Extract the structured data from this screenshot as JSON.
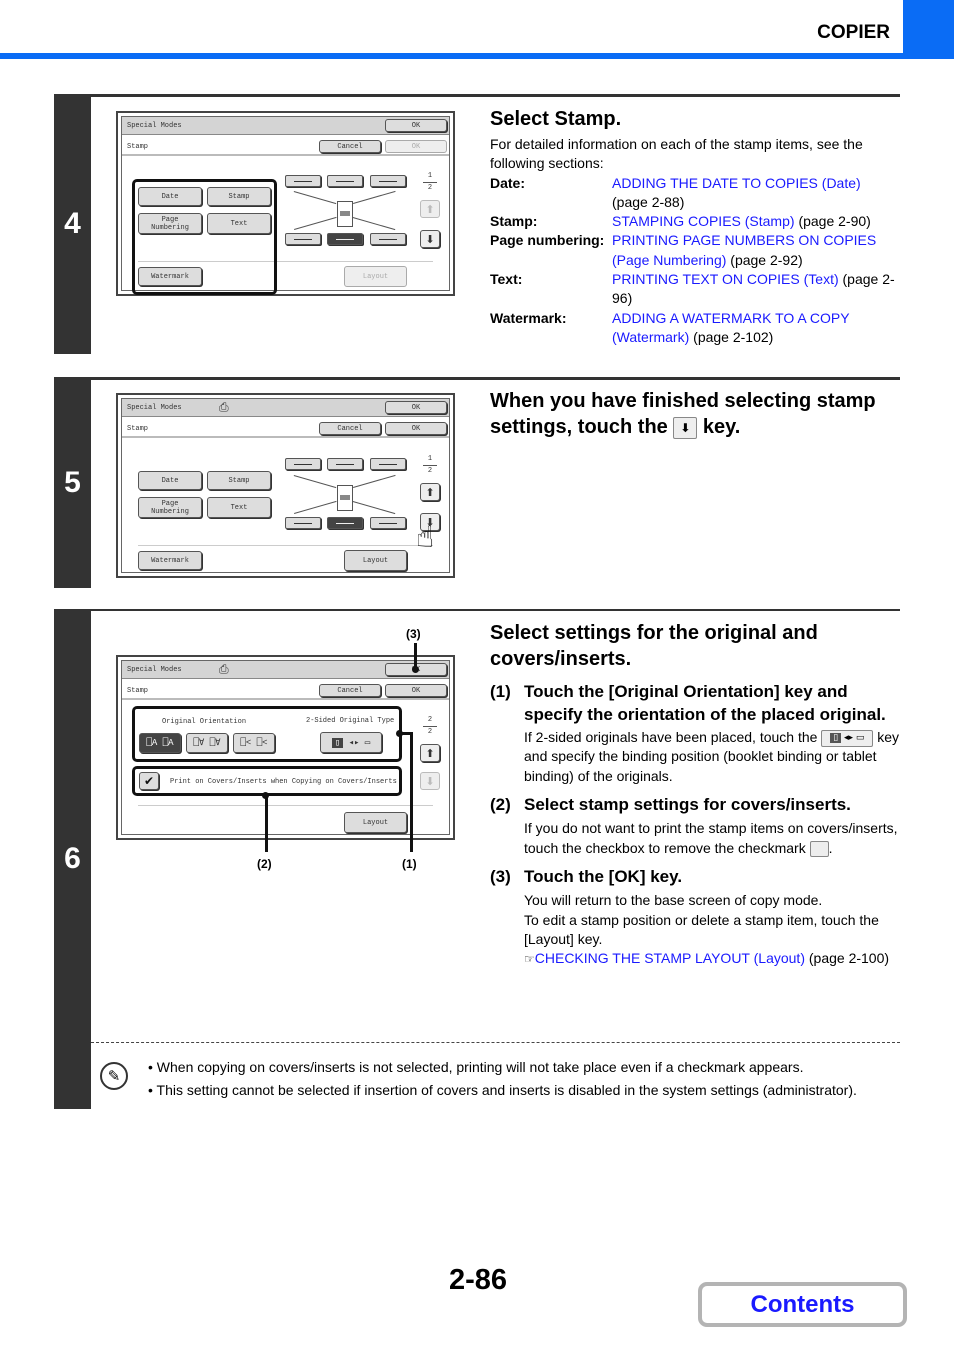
{
  "header": {
    "section_title": "COPIER",
    "accent_color": "#0a6cf5"
  },
  "steps": [
    {
      "number": "4",
      "title": "Select Stamp.",
      "intro": "For detailed information on each of the stamp items, see the following sections:",
      "refs": [
        {
          "term": "Date:",
          "link": "ADDING THE DATE TO COPIES (Date)",
          "page": "(page 2-88)"
        },
        {
          "term": "Stamp:",
          "link": "STAMPING COPIES (Stamp)",
          "page": "(page 2-90)"
        },
        {
          "term": "Page numbering:",
          "link": "PRINTING PAGE NUMBERS ON COPIES (Page Numbering)",
          "page": "(page 2-92)"
        },
        {
          "term": "Text:",
          "link": "PRINTING TEXT ON COPIES (Text)",
          "page": "(page 2-96)"
        },
        {
          "term": "Watermark:",
          "link": "ADDING A WATERMARK TO A COPY (Watermark)",
          "page": "(page 2-102)"
        }
      ],
      "screen": {
        "special_modes": "Special Modes",
        "ok": "OK",
        "stamp": "Stamp",
        "cancel": "Cancel",
        "buttons": [
          "Date",
          "Stamp",
          "Page\nNumbering",
          "Text"
        ],
        "watermark": "Watermark",
        "layout": "Layout",
        "page_current": "1",
        "page_total": "2"
      }
    },
    {
      "number": "5",
      "title_before": "When you have finished selecting stamp settings, touch the",
      "key_icon": "down-arrow",
      "title_after": "key.",
      "screen": {
        "special_modes": "Special Modes",
        "ok": "OK",
        "stamp": "Stamp",
        "cancel": "Cancel",
        "ok2": "OK",
        "buttons": [
          "Date",
          "Stamp",
          "Page\nNumbering",
          "Text"
        ],
        "watermark": "Watermark",
        "layout": "Layout",
        "page_current": "1",
        "page_total": "2"
      }
    },
    {
      "number": "6",
      "title": "Select settings for the original and covers/inserts.",
      "subs": [
        {
          "num": "(1)",
          "title": "Touch the [Original Orientation] key and specify the orientation of the placed original.",
          "text_before": "If 2-sided originals have been placed, touch the",
          "text_after": "key and specify the binding position (booklet binding or tablet binding) of the originals."
        },
        {
          "num": "(2)",
          "title": "Select stamp settings for covers/inserts.",
          "text_before": "If you do not want to print the stamp items on covers/inserts, touch the checkbox to remove the checkmark",
          "text_after": "."
        },
        {
          "num": "(3)",
          "title": "Touch the [OK] key.",
          "line1": "You will return to the base screen of copy mode.",
          "line2": "To edit a stamp position or delete a stamp item, touch the [Layout] key.",
          "ref_link": "CHECKING THE STAMP LAYOUT (Layout)",
          "ref_page": "(page 2-100)"
        }
      ],
      "screen": {
        "special_modes": "Special Modes",
        "ok": "OK",
        "stamp": "Stamp",
        "cancel": "Cancel",
        "ok2": "OK",
        "orientation_label": "Original Orientation",
        "two_sided_label": "2-Sided Original Type",
        "covers_checkbox": "Print on Covers/Inserts when Copying on Covers/Inserts",
        "covers_checked": true,
        "layout": "Layout",
        "page_current": "2",
        "page_total": "2"
      },
      "callouts": [
        "(1)",
        "(2)",
        "(3)"
      ]
    }
  ],
  "notes": [
    "When copying on covers/inserts is not selected, printing will not take place even if a checkmark appears.",
    "This setting cannot be selected if insertion of covers and inserts is disabled in the system settings (administrator)."
  ],
  "footer": {
    "page_number": "2-86",
    "contents_label": "Contents"
  }
}
